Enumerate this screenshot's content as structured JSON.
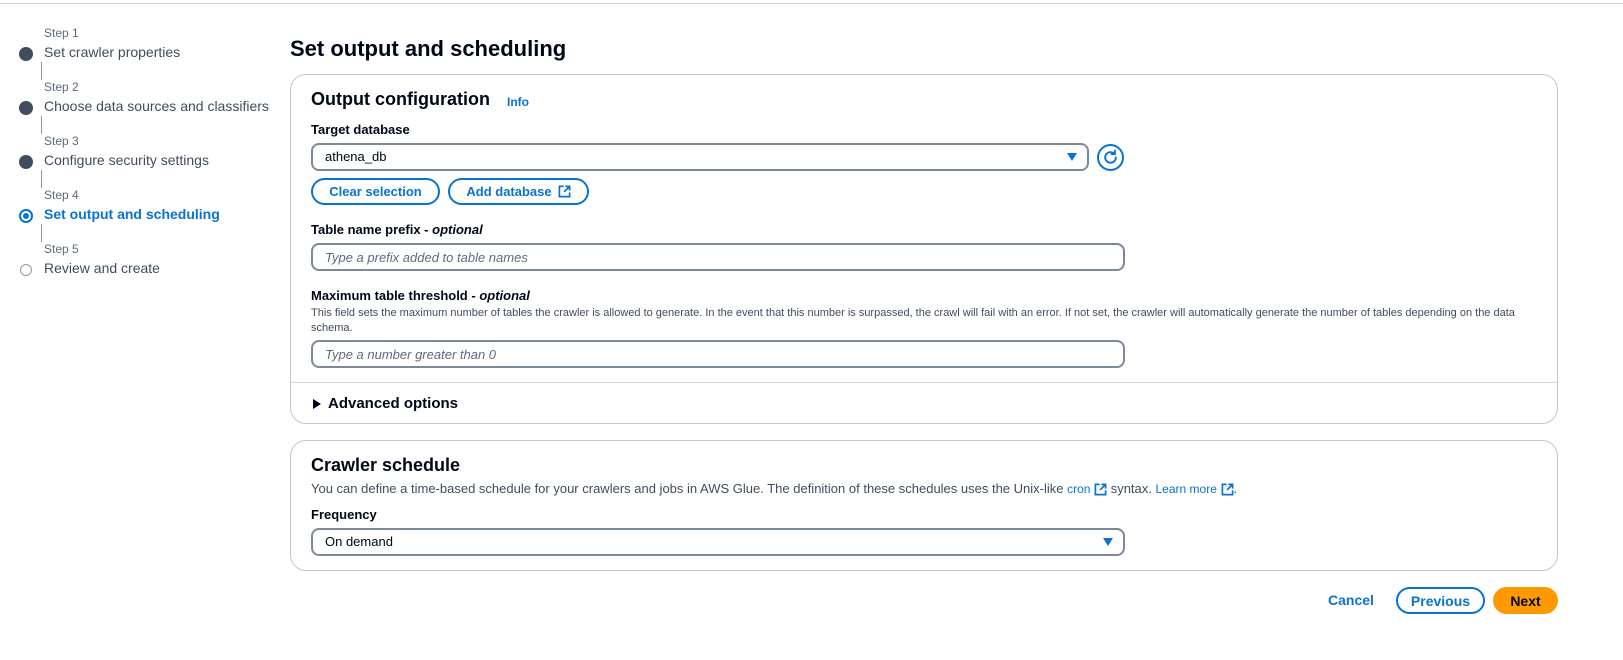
{
  "steps": [
    {
      "num": "Step 1",
      "title": "Set crawler properties",
      "state": "complete"
    },
    {
      "num": "Step 2",
      "title": "Choose data sources and classifiers",
      "state": "complete"
    },
    {
      "num": "Step 3",
      "title": "Configure security settings",
      "state": "complete"
    },
    {
      "num": "Step 4",
      "title": "Set output and scheduling",
      "state": "current"
    },
    {
      "num": "Step 5",
      "title": "Review and create",
      "state": "future"
    }
  ],
  "page": {
    "title": "Set output and scheduling"
  },
  "output": {
    "heading": "Output configuration",
    "info": "Info",
    "target_db_label": "Target database",
    "target_db_value": "athena_db",
    "clear_selection": "Clear selection",
    "add_database": "Add database",
    "prefix_label": "Table name prefix - ",
    "prefix_optional": "optional",
    "prefix_placeholder": "Type a prefix added to table names",
    "threshold_label": "Maximum table threshold - ",
    "threshold_optional": "optional",
    "threshold_desc": "This field sets the maximum number of tables the crawler is allowed to generate. In the event that this number is surpassed, the crawl will fail with an error. If not set, the crawler will automatically generate the number of tables depending on the data schema.",
    "threshold_placeholder": "Type a number greater than 0",
    "advanced": "Advanced options"
  },
  "schedule": {
    "heading": "Crawler schedule",
    "desc_part1": "You can define a time-based schedule for your crawlers and jobs in AWS Glue. The definition of these schedules uses the Unix-like ",
    "cron_link": "cron",
    "desc_part2": " syntax. ",
    "learn_more": "Learn more",
    "desc_end": ".",
    "frequency_label": "Frequency",
    "frequency_value": "On demand"
  },
  "footer": {
    "cancel": "Cancel",
    "previous": "Previous",
    "next": "Next"
  },
  "colors": {
    "accent": "#0972d3",
    "primary_button": "#ff9900"
  }
}
